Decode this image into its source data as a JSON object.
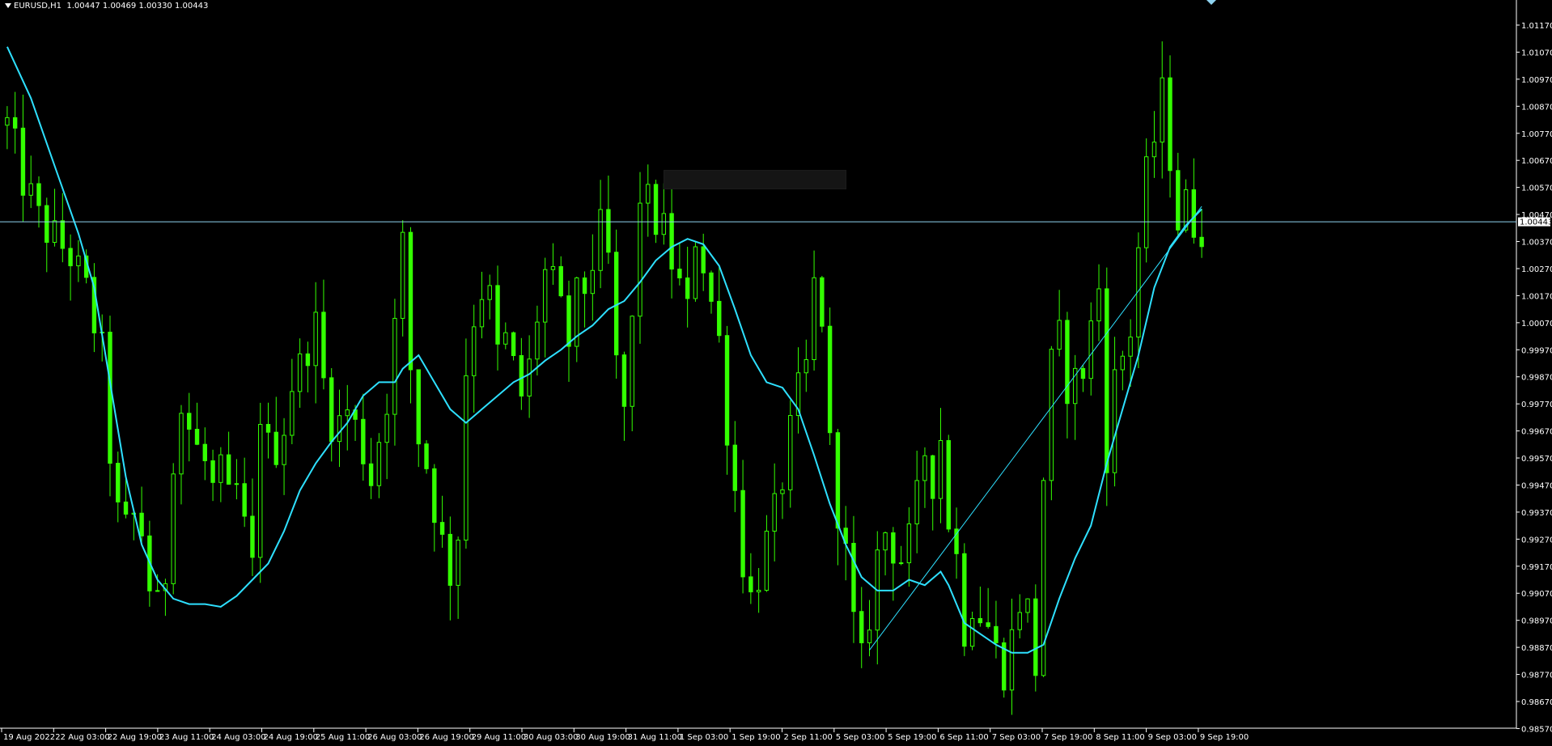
{
  "header": {
    "symbol_label": "EURUSD,H1",
    "ohlc_label": "1.00447 1.00469 1.00330 1.00443"
  },
  "colors": {
    "background": "#000000",
    "candles": "#33ff00",
    "moving_average": "#2ee0ff",
    "trendline": "#2ee0ff",
    "price_line": "#8fd3f0",
    "price_marker_bg": "#ffffff",
    "price_marker_text": "#000000",
    "axis": "#ffffff"
  },
  "current_price": "1.00443",
  "chart_data": {
    "type": "candlestick",
    "symbol": "EURUSD",
    "timeframe": "H1",
    "ylim": [
      0.9855,
      1.0125
    ],
    "y_ticks": [
      "1.01170",
      "1.01070",
      "1.00970",
      "1.00870",
      "1.00770",
      "1.00670",
      "1.00570",
      "1.00470",
      "1.00370",
      "1.00270",
      "1.00170",
      "1.00070",
      "0.99970",
      "0.99870",
      "0.99770",
      "0.99670",
      "0.99570",
      "0.99470",
      "0.99370",
      "0.99270",
      "0.99170",
      "0.99070",
      "0.98970",
      "0.98870",
      "0.98770",
      "0.98670",
      "0.98570"
    ],
    "x_ticks": [
      "19 Aug 2022",
      "22 Aug 03:00",
      "22 Aug 19:00",
      "23 Aug 11:00",
      "24 Aug 03:00",
      "24 Aug 19:00",
      "25 Aug 11:00",
      "26 Aug 03:00",
      "26 Aug 19:00",
      "29 Aug 11:00",
      "30 Aug 03:00",
      "30 Aug 19:00",
      "31 Aug 11:00",
      "1 Sep 03:00",
      "1 Sep 19:00",
      "2 Sep 11:00",
      "5 Sep 03:00",
      "5 Sep 19:00",
      "6 Sep 11:00",
      "7 Sep 03:00",
      "7 Sep 19:00",
      "8 Sep 11:00",
      "9 Sep 03:00",
      "9 Sep 19:00"
    ],
    "close_path": [
      [
        0,
        1.008
      ],
      [
        2,
        1.006
      ],
      [
        4,
        1.0045
      ],
      [
        6,
        1.0038
      ],
      [
        8,
        1.0032
      ],
      [
        10,
        1.0018
      ],
      [
        12,
        0.9995
      ],
      [
        13,
        0.996
      ],
      [
        14,
        0.9935
      ],
      [
        15,
        0.993
      ],
      [
        16,
        0.9935
      ],
      [
        17,
        0.993
      ],
      [
        18,
        0.991
      ],
      [
        19,
        0.99
      ],
      [
        20,
        0.9915
      ],
      [
        21,
        0.996
      ],
      [
        22,
        0.9975
      ],
      [
        23,
        0.9968
      ],
      [
        24,
        0.996
      ],
      [
        25,
        0.9955
      ],
      [
        26,
        0.9945
      ],
      [
        27,
        0.995
      ],
      [
        28,
        0.994
      ],
      [
        29,
        0.9945
      ],
      [
        30,
        0.993
      ],
      [
        31,
        0.9915
      ],
      [
        32,
        0.9975
      ],
      [
        33,
        0.996
      ],
      [
        34,
        0.9962
      ],
      [
        35,
        0.997
      ],
      [
        36,
        0.9985
      ],
      [
        37,
        0.999
      ],
      [
        38,
        1.0
      ],
      [
        39,
        1.0005
      ],
      [
        40,
        0.9985
      ],
      [
        41,
        0.9972
      ],
      [
        42,
        0.997
      ],
      [
        43,
        0.9975
      ],
      [
        44,
        0.9968
      ],
      [
        45,
        0.996
      ],
      [
        46,
        0.995
      ],
      [
        47,
        0.9965
      ],
      [
        48,
        0.998
      ],
      [
        49,
        1.0005
      ],
      [
        50,
        1.0035
      ],
      [
        51,
        0.999
      ],
      [
        52,
        0.9965
      ],
      [
        53,
        0.9955
      ],
      [
        54,
        0.994
      ],
      [
        55,
        0.9925
      ],
      [
        56,
        0.9915
      ],
      [
        57,
        0.993
      ],
      [
        58,
        0.999
      ],
      [
        59,
        1.001
      ],
      [
        60,
        1.002
      ],
      [
        61,
        1.0015
      ],
      [
        62,
        0.9995
      ],
      [
        63,
        1.0
      ],
      [
        64,
        0.999
      ],
      [
        65,
        0.998
      ],
      [
        66,
        0.999
      ],
      [
        67,
        1.001
      ],
      [
        68,
        1.0025
      ],
      [
        69,
        1.002
      ],
      [
        70,
        1.001
      ],
      [
        71,
        1.0
      ],
      [
        72,
        1.0015
      ],
      [
        73,
        1.002
      ],
      [
        74,
        1.003
      ],
      [
        75,
        1.004
      ],
      [
        76,
        1.003
      ],
      [
        77,
        0.999
      ],
      [
        78,
        0.9975
      ],
      [
        79,
        1.0005
      ],
      [
        80,
        1.0055
      ],
      [
        81,
        1.005
      ],
      [
        82,
        1.0045
      ],
      [
        83,
        1.004
      ],
      [
        84,
        1.003
      ],
      [
        85,
        1.002
      ],
      [
        86,
        1.001
      ],
      [
        87,
        1.004
      ],
      [
        88,
        1.003
      ],
      [
        89,
        1.0015
      ],
      [
        90,
        1.0
      ],
      [
        91,
        0.997
      ],
      [
        92,
        0.9945
      ],
      [
        93,
        0.992
      ],
      [
        94,
        0.9905
      ],
      [
        95,
        0.9915
      ],
      [
        96,
        0.9925
      ],
      [
        97,
        0.9935
      ],
      [
        98,
        0.995
      ],
      [
        99,
        0.9965
      ],
      [
        100,
        0.998
      ],
      [
        101,
        0.999
      ],
      [
        102,
        1.002
      ],
      [
        103,
        1.001
      ],
      [
        104,
        0.996
      ],
      [
        105,
        0.994
      ],
      [
        106,
        0.992
      ],
      [
        107,
        0.9895
      ],
      [
        108,
        0.988
      ],
      [
        109,
        0.99
      ],
      [
        110,
        0.992
      ],
      [
        111,
        0.993
      ],
      [
        112,
        0.9925
      ],
      [
        113,
        0.992
      ],
      [
        114,
        0.9925
      ],
      [
        115,
        0.994
      ],
      [
        116,
        0.996
      ],
      [
        117,
        0.995
      ],
      [
        118,
        0.9965
      ],
      [
        119,
        0.9935
      ],
      [
        120,
        0.992
      ],
      [
        121,
        0.9895
      ],
      [
        122,
        0.9905
      ],
      [
        123,
        0.99
      ],
      [
        124,
        0.9895
      ],
      [
        125,
        0.9885
      ],
      [
        126,
        0.988
      ],
      [
        127,
        0.989
      ],
      [
        128,
        0.9905
      ],
      [
        129,
        0.99
      ],
      [
        130,
        0.988
      ],
      [
        131,
        0.995
      ],
      [
        132,
        0.999
      ],
      [
        133,
        1.0
      ],
      [
        134,
        0.9985
      ],
      [
        135,
        0.9985
      ],
      [
        136,
        0.999
      ],
      [
        137,
        1.0005
      ],
      [
        138,
        1.002
      ],
      [
        139,
        0.996
      ],
      [
        140,
        0.9985
      ],
      [
        141,
        0.9995
      ],
      [
        142,
        1.0005
      ],
      [
        143,
        1.0035
      ],
      [
        144,
        1.006
      ],
      [
        145,
        1.0075
      ],
      [
        146,
        1.009
      ],
      [
        147,
        1.007
      ],
      [
        148,
        1.0045
      ],
      [
        149,
        1.005
      ],
      [
        150,
        1.0045
      ],
      [
        151,
        1.0044
      ]
    ],
    "moving_average_path": [
      [
        0,
        1.0109
      ],
      [
        3,
        1.009
      ],
      [
        6,
        1.0065
      ],
      [
        9,
        1.004
      ],
      [
        11,
        1.002
      ],
      [
        13,
        0.9985
      ],
      [
        15,
        0.995
      ],
      [
        17,
        0.9925
      ],
      [
        19,
        0.9912
      ],
      [
        21,
        0.9905
      ],
      [
        23,
        0.9903
      ],
      [
        25,
        0.9903
      ],
      [
        27,
        0.9902
      ],
      [
        29,
        0.9906
      ],
      [
        31,
        0.9912
      ],
      [
        33,
        0.9918
      ],
      [
        35,
        0.993
      ],
      [
        37,
        0.9945
      ],
      [
        39,
        0.9955
      ],
      [
        41,
        0.9963
      ],
      [
        43,
        0.997
      ],
      [
        45,
        0.998
      ],
      [
        47,
        0.9985
      ],
      [
        49,
        0.9985
      ],
      [
        50,
        0.999
      ],
      [
        52,
        0.9995
      ],
      [
        54,
        0.9985
      ],
      [
        56,
        0.9975
      ],
      [
        58,
        0.997
      ],
      [
        60,
        0.9975
      ],
      [
        62,
        0.998
      ],
      [
        64,
        0.9985
      ],
      [
        66,
        0.9988
      ],
      [
        68,
        0.9993
      ],
      [
        70,
        0.9997
      ],
      [
        72,
        1.0002
      ],
      [
        74,
        1.0006
      ],
      [
        76,
        1.0012
      ],
      [
        78,
        1.0015
      ],
      [
        80,
        1.0022
      ],
      [
        82,
        1.003
      ],
      [
        84,
        1.0035
      ],
      [
        86,
        1.0038
      ],
      [
        88,
        1.0036
      ],
      [
        90,
        1.0028
      ],
      [
        92,
        1.0012
      ],
      [
        94,
        0.9995
      ],
      [
        96,
        0.9985
      ],
      [
        98,
        0.9983
      ],
      [
        100,
        0.9975
      ],
      [
        102,
        0.9958
      ],
      [
        104,
        0.994
      ],
      [
        106,
        0.9925
      ],
      [
        108,
        0.9913
      ],
      [
        110,
        0.9908
      ],
      [
        112,
        0.9908
      ],
      [
        114,
        0.9912
      ],
      [
        116,
        0.991
      ],
      [
        118,
        0.9915
      ],
      [
        119,
        0.991
      ],
      [
        121,
        0.9896
      ],
      [
        123,
        0.9892
      ],
      [
        125,
        0.9888
      ],
      [
        127,
        0.9885
      ],
      [
        129,
        0.9885
      ],
      [
        131,
        0.9888
      ],
      [
        133,
        0.9905
      ],
      [
        135,
        0.992
      ],
      [
        137,
        0.9932
      ],
      [
        139,
        0.9955
      ],
      [
        141,
        0.9975
      ],
      [
        143,
        0.9995
      ],
      [
        145,
        1.002
      ],
      [
        147,
        1.0035
      ],
      [
        149,
        1.0043
      ],
      [
        151,
        1.0049
      ]
    ],
    "trendline": [
      [
        109,
        0.9886
      ],
      [
        151,
        1.005
      ]
    ],
    "current_price_line": 1.00443
  }
}
